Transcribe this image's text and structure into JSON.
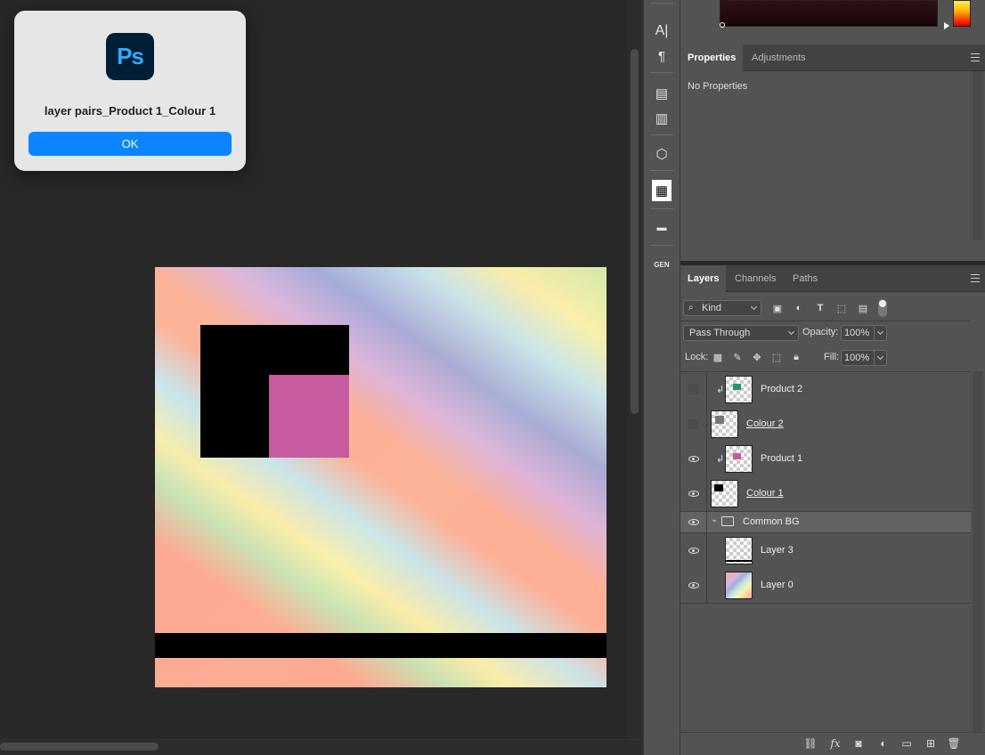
{
  "dialog": {
    "app_logo_text": "Ps",
    "message": "layer pairs_Product 1_Colour 1",
    "ok_label": "OK"
  },
  "tools": [
    {
      "name": "character-tool",
      "glyph": "A|"
    },
    {
      "name": "paragraph-tool",
      "glyph": "¶"
    },
    {
      "name": "glyphs-tool",
      "glyph": "▤"
    },
    {
      "name": "notes-tool",
      "glyph": "▥"
    },
    {
      "name": "3d-tool",
      "glyph": "⬡"
    },
    {
      "name": "plugin-tool",
      "glyph": "▦"
    },
    {
      "name": "libraries-tool",
      "glyph": "▬"
    },
    {
      "name": "generator-tool",
      "glyph": "GEN"
    }
  ],
  "properties_panel": {
    "tabs": [
      "Properties",
      "Adjustments"
    ],
    "active_tab": "Properties",
    "content": "No Properties"
  },
  "layers_panel": {
    "tabs": [
      "Layers",
      "Channels",
      "Paths"
    ],
    "active_tab": "Layers",
    "filter_kind": "Kind",
    "blend_mode": "Pass Through",
    "opacity_label": "Opacity:",
    "opacity_value": "100%",
    "lock_label": "Lock:",
    "fill_label": "Fill:",
    "fill_value": "100%",
    "layers": [
      {
        "name": "Product 2",
        "visible": false,
        "clipped": true,
        "underlined": false,
        "thumb_color": "#1a9c6a"
      },
      {
        "name": "Colour 2",
        "visible": false,
        "clipped": false,
        "underlined": true,
        "thumb_color": "#777777"
      },
      {
        "name": "Product 1",
        "visible": true,
        "clipped": true,
        "underlined": false,
        "thumb_color": "#c65ba0"
      },
      {
        "name": "Colour 1",
        "visible": true,
        "clipped": false,
        "underlined": true,
        "thumb_color": "#000000"
      },
      {
        "name": "Common BG",
        "visible": true,
        "group": true
      },
      {
        "name": "Layer 3",
        "visible": true,
        "clipped": false,
        "underlined": false,
        "thumb_color": "#000000"
      },
      {
        "name": "Layer 0",
        "visible": true,
        "clipped": false,
        "underlined": false,
        "thumb_color": "rainbow"
      }
    ]
  },
  "colors": {
    "accent": "#0a84ff",
    "panel_bg": "#535353",
    "canvas_bg": "#282828",
    "pink_shape": "#c65ba0"
  }
}
